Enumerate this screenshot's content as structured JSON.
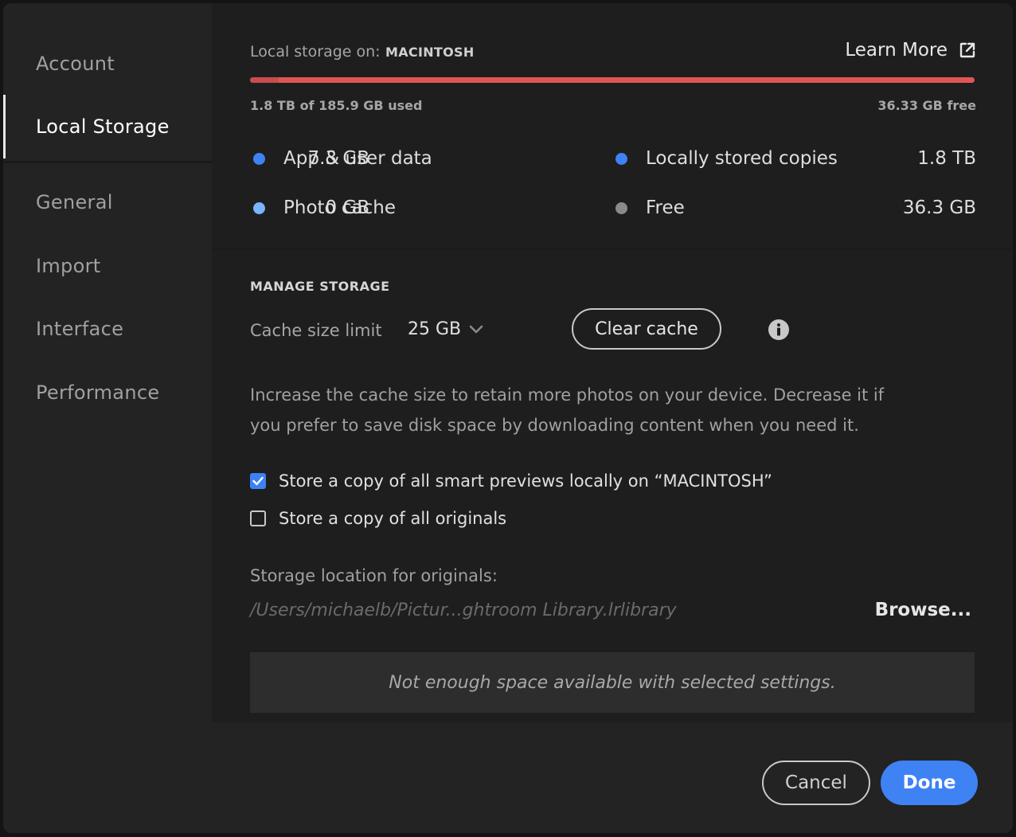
{
  "sidebar": {
    "items": [
      {
        "label": "Account",
        "active": false
      },
      {
        "label": "Local Storage",
        "active": true
      },
      {
        "label": "General",
        "active": false
      },
      {
        "label": "Import",
        "active": false
      },
      {
        "label": "Interface",
        "active": false
      },
      {
        "label": "Performance",
        "active": false
      }
    ]
  },
  "storage": {
    "label": "Local storage on:",
    "drive": "MACINTOSH",
    "learn_more": "Learn More",
    "learn_more_icon": "external-link-icon",
    "used_text": "1.8 TB of 185.9 GB used",
    "free_text": "36.33 GB free",
    "bar_app_fraction": 0.04,
    "colors": {
      "bar": "#e05655",
      "app_dot": "#3e82f4",
      "photo_dot": "#7ab3ff",
      "copies_dot": "#3e82f4",
      "free_dot": "#8a8a8a"
    },
    "legend": [
      {
        "label": "App & user data",
        "value": "7.3 GB"
      },
      {
        "label": "Photo cache",
        "value": "0 GB"
      },
      {
        "label": "Locally stored copies",
        "value": "1.8 TB"
      },
      {
        "label": "Free",
        "value": "36.3 GB"
      }
    ]
  },
  "manage": {
    "title": "MANAGE STORAGE",
    "cache_label": "Cache size limit",
    "cache_value": "25 GB",
    "clear_cache": "Clear cache",
    "info_icon": "info-icon",
    "description": "Increase the cache size to retain more photos on your device. Decrease it if you prefer to save disk space by downloading content when you need it.",
    "smart_previews": {
      "label": "Store a copy of all smart previews locally on “MACINTOSH”",
      "checked": true
    },
    "originals": {
      "label": "Store a copy of all originals",
      "checked": false
    },
    "location_label": "Storage location for originals:",
    "location_path": "/Users/michaelb/Pictur...ghtroom Library.lrlibrary",
    "browse": "Browse...",
    "warning": "Not enough space available with selected settings."
  },
  "footer": {
    "cancel": "Cancel",
    "done": "Done"
  }
}
